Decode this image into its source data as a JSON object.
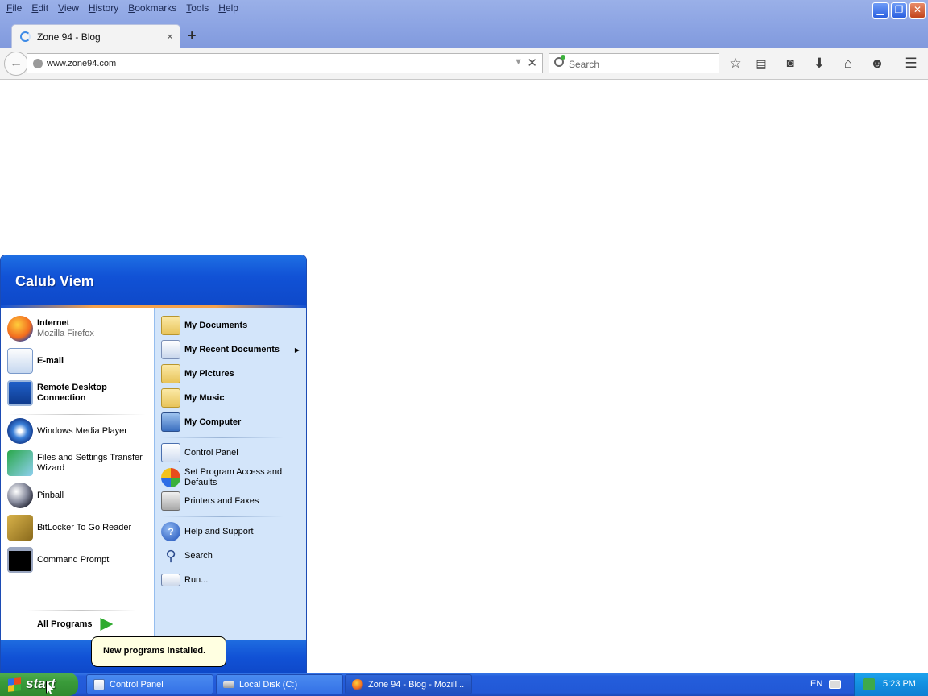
{
  "browser": {
    "menu": [
      "File",
      "Edit",
      "View",
      "History",
      "Bookmarks",
      "Tools",
      "Help"
    ],
    "tab_title": "Zone 94 - Blog",
    "url": "www.zone94.com",
    "search_placeholder": "Search",
    "window_controls": {
      "minimize": "minimize-icon",
      "restore": "restore-icon",
      "close": "close-icon"
    },
    "toolbar_icons": [
      "star-icon",
      "reading-list-icon",
      "pocket-icon",
      "download-icon",
      "home-icon",
      "smiley-icon",
      "hamburger-menu-icon"
    ]
  },
  "start_menu": {
    "user": "Calub Viem",
    "pinned": [
      {
        "title": "Internet",
        "subtitle": "Mozilla Firefox",
        "icon": "firefox-icon"
      },
      {
        "title": "E-mail",
        "icon": "email-icon"
      }
    ],
    "pinned_extra": {
      "title_line1": "Remote Desktop",
      "title_line2": "Connection",
      "icon": "remote-desktop-icon"
    },
    "recent": [
      {
        "label": "Windows Media Player",
        "icon": "media-player-icon"
      },
      {
        "label_line1": "Files and Settings Transfer",
        "label_line2": "Wizard",
        "icon": "transfer-wizard-icon"
      },
      {
        "label": "Pinball",
        "icon": "pinball-icon"
      },
      {
        "label": "BitLocker To Go Reader",
        "icon": "bitlocker-icon"
      },
      {
        "label": "Command Prompt",
        "icon": "command-prompt-icon"
      }
    ],
    "all_programs": "All Programs",
    "places": [
      {
        "label": "My Documents",
        "icon": "my-documents-icon"
      },
      {
        "label": "My Recent Documents",
        "icon": "recent-documents-icon"
      },
      {
        "label": "My Pictures",
        "icon": "my-pictures-icon"
      },
      {
        "label": "My Music",
        "icon": "my-music-icon"
      },
      {
        "label": "My Computer",
        "icon": "my-computer-icon"
      }
    ],
    "settings": [
      {
        "label": "Control Panel",
        "icon": "control-panel-icon"
      },
      {
        "label_line1": "Set Program Access and",
        "label_line2": "Defaults",
        "icon": "program-access-icon"
      },
      {
        "label": "Printers and Faxes",
        "icon": "printer-icon"
      }
    ],
    "help": [
      {
        "label": "Help and Support",
        "icon": "help-icon"
      },
      {
        "label": "Search",
        "icon": "search-icon"
      },
      {
        "label": "Run...",
        "icon": "run-icon"
      }
    ]
  },
  "balloon": "New programs installed.",
  "taskbar": {
    "start_label": "start",
    "tasks": [
      {
        "label": "Control Panel",
        "icon": "control-panel-icon"
      },
      {
        "label": "Local Disk (C:)",
        "icon": "drive-icon"
      },
      {
        "label": "Zone 94 - Blog - Mozill...",
        "icon": "firefox-icon"
      }
    ],
    "language": "EN",
    "clock": "5:23 PM"
  },
  "colors": {
    "xp_blue": "#1152d6",
    "start_green": "#3a9b3a",
    "places_panel": "#d3e5fa",
    "balloon": "#ffffe1"
  }
}
